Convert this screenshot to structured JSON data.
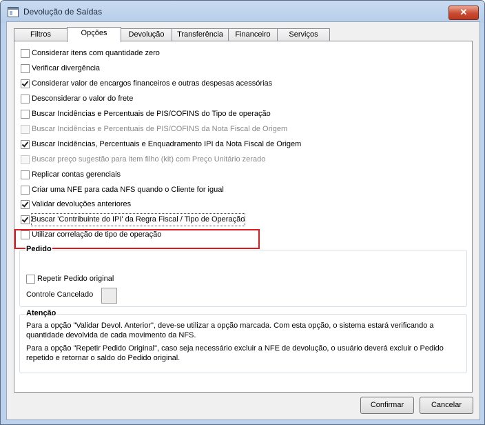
{
  "window": {
    "title": "Devolução de Saídas",
    "close_glyph": "✕"
  },
  "tabs": [
    {
      "label": "Filtros"
    },
    {
      "label": "Opções"
    },
    {
      "label": "Devolução"
    },
    {
      "label": "Transferência"
    },
    {
      "label": "Financeiro"
    },
    {
      "label": "Serviços"
    }
  ],
  "active_tab": "Opções",
  "options": [
    {
      "label": "Considerar itens com quantidade zero",
      "checked": false,
      "enabled": true
    },
    {
      "label": "Verificar divergência",
      "checked": false,
      "enabled": true
    },
    {
      "label": "Considerar valor de encargos financeiros e outras despesas acessórias",
      "checked": true,
      "enabled": true
    },
    {
      "label": "Desconsiderar o valor do frete",
      "checked": false,
      "enabled": true
    },
    {
      "label": "Buscar Incidências e Percentuais de PIS/COFINS do Tipo de operação",
      "checked": false,
      "enabled": true
    },
    {
      "label": "Buscar Incidências e Percentuais de PIS/COFINS da Nota Fiscal de Origem",
      "checked": false,
      "enabled": false
    },
    {
      "label": "Buscar Incidências, Percentuais e Enquadramento IPI da Nota Fiscal de Origem",
      "checked": true,
      "enabled": true
    },
    {
      "label": "Buscar preço sugestão para item filho (kit) com Preço Unitário zerado",
      "checked": false,
      "enabled": false
    },
    {
      "label": "Replicar contas gerenciais",
      "checked": false,
      "enabled": true
    },
    {
      "label": "Criar uma NFE para cada NFS quando o Cliente for igual",
      "checked": false,
      "enabled": true
    },
    {
      "label": "Validar devoluções anteriores",
      "checked": true,
      "enabled": true
    },
    {
      "label": "Buscar 'Contribuinte do IPI' da Regra Fiscal / Tipo de Operação",
      "checked": true,
      "enabled": true,
      "highlighted": true
    },
    {
      "label": "Utilizar correlação de tipo de operação",
      "checked": false,
      "enabled": true
    }
  ],
  "pedido": {
    "title": "Pedido",
    "repetir_label": "Repetir Pedido original",
    "repetir_checked": false,
    "controle_label": "Controle Cancelado"
  },
  "atencao": {
    "title": "Atenção",
    "note1": "Para a opção \"Validar Devol. Anterior\", deve-se utilizar a opção marcada. Com esta opção, o sistema estará verificando a quantidade devolvida de cada movimento da NFS.",
    "note2": "Para a opção \"Repetir Pedido Original\", caso seja necessário excluir a NFE de devolução, o usuário deverá excluir o Pedido repetido e retornar o saldo do Pedido original."
  },
  "buttons": {
    "confirm": "Confirmar",
    "cancel": "Cancelar"
  },
  "colors": {
    "highlight_border": "#e0181f",
    "close_button": "#c94a2f",
    "titlebar": "#bcd2ec"
  }
}
